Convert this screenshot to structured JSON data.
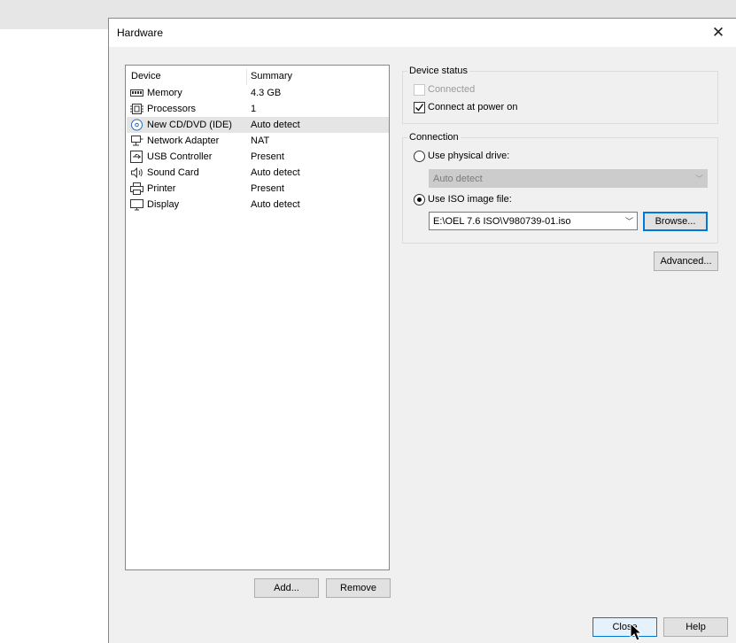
{
  "dialog": {
    "title": "Hardware"
  },
  "device_list": {
    "headers": {
      "device": "Device",
      "summary": "Summary"
    },
    "items": [
      {
        "name": "Memory",
        "summary": "4.3 GB",
        "icon": "memory-icon"
      },
      {
        "name": "Processors",
        "summary": "1",
        "icon": "processor-icon"
      },
      {
        "name": "New CD/DVD (IDE)",
        "summary": "Auto detect",
        "icon": "cd-dvd-icon",
        "selected": true
      },
      {
        "name": "Network Adapter",
        "summary": "NAT",
        "icon": "network-adapter-icon"
      },
      {
        "name": "USB Controller",
        "summary": "Present",
        "icon": "usb-icon"
      },
      {
        "name": "Sound Card",
        "summary": "Auto detect",
        "icon": "speaker-icon"
      },
      {
        "name": "Printer",
        "summary": "Present",
        "icon": "printer-icon"
      },
      {
        "name": "Display",
        "summary": "Auto detect",
        "icon": "monitor-icon"
      }
    ],
    "add_label": "Add...",
    "remove_label": "Remove"
  },
  "device_status": {
    "label": "Device status",
    "connected": {
      "label": "Connected",
      "checked": false,
      "enabled": false
    },
    "connect_at_power_on": {
      "label": "Connect at power on",
      "checked": true
    }
  },
  "connection": {
    "label": "Connection",
    "physical": {
      "label": "Use physical drive:",
      "selected": false,
      "value": "Auto detect"
    },
    "iso": {
      "label": "Use ISO image file:",
      "selected": true,
      "value": "E:\\OEL 7.6 ISO\\V980739-01.iso"
    },
    "browse_label": "Browse..."
  },
  "advanced_label": "Advanced...",
  "footer": {
    "close_label": "Close",
    "help_label": "Help"
  }
}
